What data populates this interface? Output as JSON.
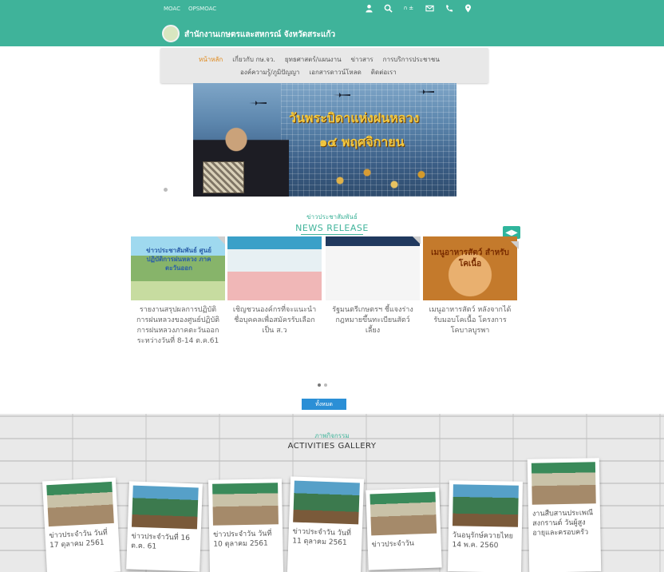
{
  "topbar": {
    "links": [
      "MOAC",
      "OPSMOAC"
    ],
    "icons": [
      "user-icon",
      "search-icon",
      "font-size-icon",
      "mail-icon",
      "phone-icon",
      "location-icon"
    ],
    "font_size_label": "ก ±",
    "site_title": "สำนักงานเกษตรและสหกรณ์ จังหวัดสระแก้ว"
  },
  "nav": {
    "row1": [
      "หน้าหลัก",
      "เกี่ยวกับ กษ.จว.",
      "ยุทธศาสตร์/แผนงาน",
      "ข่าวสาร",
      "การบริการประชาชน"
    ],
    "row2": [
      "องค์ความรู้/ภูมิปัญญา",
      "เอกสารดาวน์โหลด",
      "ติดต่อเรา"
    ],
    "active_index": 0
  },
  "hero": {
    "line1": "วันพระบิดาแห่งฝนหลวง",
    "line2": "๑๔ พฤศจิกายน"
  },
  "news": {
    "title_th": "ข่าวประชาสัมพันธ์",
    "title_en": "NEWS RELEASE",
    "arrow_label": "◀▶",
    "cards": [
      {
        "title": "รายงานสรุปผลการปฏิบัติการฝนหลวงของศูนย์ปฏิบัติการฝนหลวงภาคตะวันออก ระหว่างวันที่ 8-14 ต.ค.61",
        "image_text": "ข่าวประชาสัมพันธ์ ศูนย์ปฏิบัติการฝนหลวง ภาคตะวันออก"
      },
      {
        "title": "เชิญชวนองค์กรที่จะแนะนำชื่อบุคคลเพื่อสมัครรับเลือกเป็น ส.ว",
        "image_text": ""
      },
      {
        "title": "รัฐมนตรีเกษตรฯ ชี้แจงร่างกฎหมายขึ้นทะเบียนสัตว์เลี้ยง",
        "image_text": ""
      },
      {
        "title": "เมนูอาหารสัตว์ หลังจากได้รับมอบโคเนื้อ โครงการโคบาลบูรพา",
        "image_text": "เมนูอาหารสัตว์ สำหรับโคเนื้อ"
      }
    ],
    "more_label": "ทั้งหมด"
  },
  "gallery": {
    "title_th": "ภาพกิจกรรม",
    "title_en": "ACTIVITIES GALLERY",
    "items": [
      {
        "caption": "ข่าวประจำวัน วันที่ 17 ตุลาคม 2561"
      },
      {
        "caption": "ข่าวประจำวันที่ 16 ต.ค. 61"
      },
      {
        "caption": "ข่าวประจำวัน วันที่ 10 ตุลาคม 2561"
      },
      {
        "caption": "ข่าวประจำวัน วันที่ 11 ตุลาคม 2561"
      },
      {
        "caption": "ข่าวประจำวัน"
      },
      {
        "caption": "วันอนุรักษ์ควายไทย 14 พ.ค. 2560"
      },
      {
        "caption": "งานสืบสานประเพณี สงกรานต์ วันผู้สูงอายุและครอบครัว"
      }
    ]
  },
  "colors": {
    "primary": "#3fb39a",
    "active_nav": "#e08a1e",
    "button": "#2b8fd6"
  }
}
